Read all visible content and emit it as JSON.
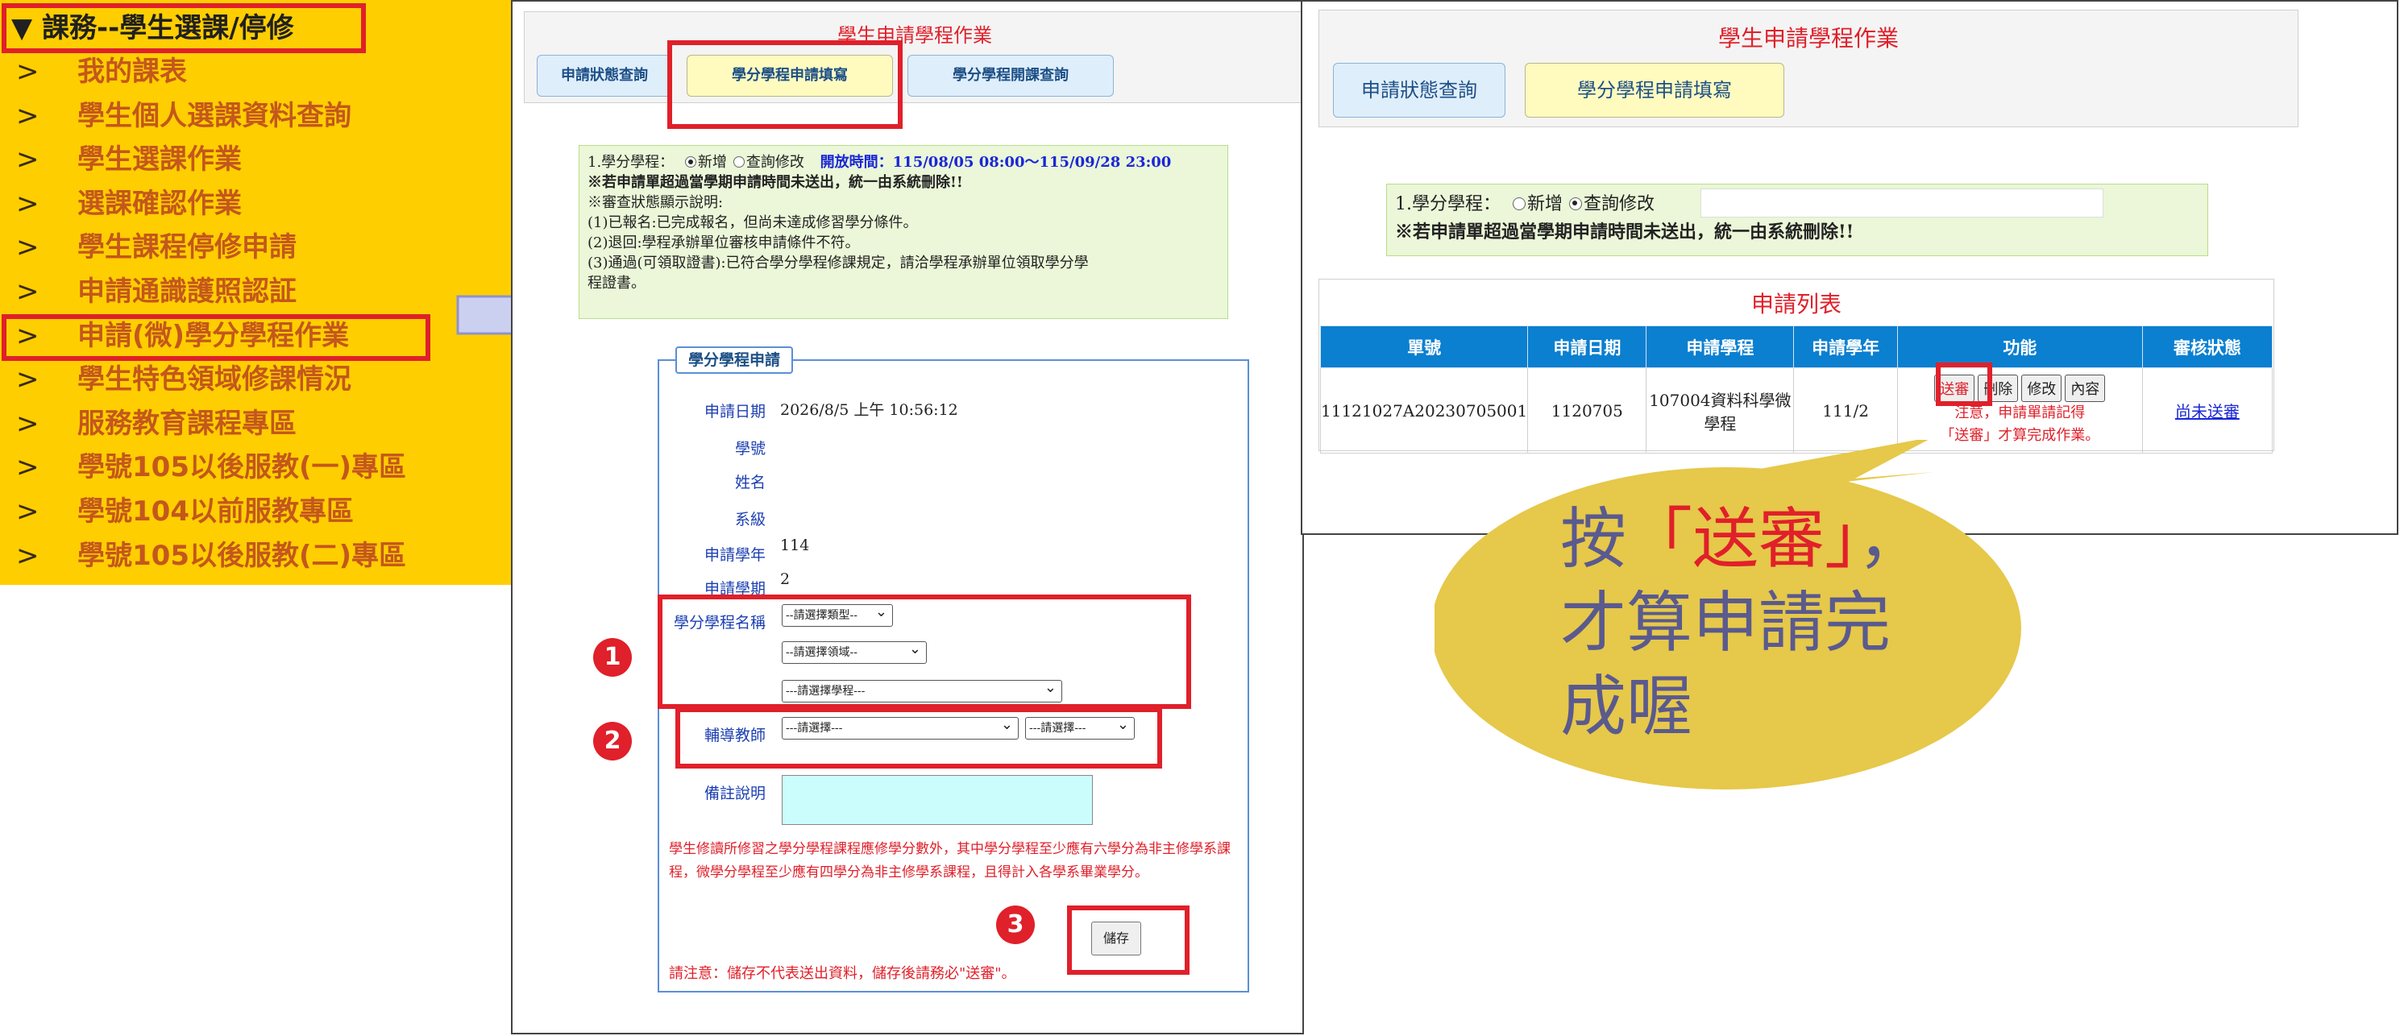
{
  "menu": {
    "header": "▼ 課務--學生選課/停修",
    "arrow_glyph": ">",
    "items": [
      "我的課表",
      "學生個人選課資料查詢",
      "學生選課作業",
      "選課確認作業",
      "學生課程停修申請",
      "申請通識護照認証",
      "申請(微)學分學程作業",
      "學生特色領域修課情況",
      "服務教育課程專區",
      "學號105以後服教(一)專區",
      "學號104以前服教專區",
      "學號105以後服教(二)專區"
    ]
  },
  "left_panel": {
    "title": "學生申請學程作業",
    "tabs": [
      "申請狀態查詢",
      "學分學程申請填寫",
      "學分學程開課查詢"
    ],
    "info": {
      "program_label": "1.學分學程：",
      "radio_new": "新增",
      "radio_query": "查詢修改",
      "open_time": "開放時間：115/08/05 08:00～115/09/28 23:00",
      "warning": "※若申請單超過當學期申請時間未送出，統一由系統刪除!!",
      "status_title": "※審查狀態顯示說明:",
      "status_1": "(1)已報名:已完成報名，但尚未達成修習學分條件。",
      "status_2": "(2)退回:學程承辦單位審核申請條件不符。",
      "status_3a": "(3)通過(可領取證書):已符合學分學程修課規定，請洽學程承辦單位領取學分學",
      "status_3b": "程證書。"
    },
    "form": {
      "legend": "學分學程申請",
      "apply_date_label": "申請日期",
      "apply_date_value": "2026/8/5 上午 10:56:12",
      "student_id_label": "學號",
      "name_label": "姓名",
      "dept_label": "系級",
      "year_label": "申請學年",
      "year_value": "114",
      "term_label": "申請學期",
      "term_value": "2",
      "program_name_label": "學分學程名稱",
      "select_type": "--請選擇類型--",
      "select_field": "--請選擇領域--",
      "select_program": "---請選擇學程---",
      "tutor_label": "輔導教師",
      "select_tutor_1": "---請選擇---",
      "select_tutor_2": "---請選擇---",
      "remark_label": "備註說明",
      "note": "學生修讀所修習之學分學程課程應修學分數外，其中學分學程至少應有六學分為非主修學系課程，微學分學程至少應有四學分為非主修學系課程，且得計入各學系畢業學分。",
      "save_label": "儲存",
      "save_note": "請注意：儲存不代表送出資料，儲存後請務必\"送審\"。"
    },
    "badges": [
      "1",
      "2",
      "3"
    ]
  },
  "right_panel": {
    "title": "學生申請學程作業",
    "tabs": [
      "申請狀態查詢",
      "學分學程申請填寫"
    ],
    "program_label": "1.學分學程：",
    "radio_new": "新增",
    "radio_query": "查詢修改",
    "warning": "※若申請單超過當學期申請時間未送出，統一由系統刪除!!",
    "list_title": "申請列表",
    "columns": [
      "單號",
      "申請日期",
      "申請學程",
      "申請學年",
      "功能",
      "審核狀態"
    ],
    "row": {
      "id": "11121027A20230705001",
      "date": "1120705",
      "program": "107004資料科學微學程",
      "year": "111/2",
      "btn_send": "送審",
      "btn_delete": "刪除",
      "btn_edit": "修改",
      "btn_content": "內容",
      "note_line1": "注意，申請單請記得",
      "note_line2": "「送審」才算完成作業。",
      "status": "尚未送審"
    }
  },
  "bubble": {
    "line1_prefix": "按",
    "line1_highlight": "「送審」",
    "line1_suffix": "，",
    "line2": "才算申請完",
    "line3": "成喔"
  },
  "colors": {
    "menu_bg": "#ffce00",
    "menu_text": "#c4571c",
    "highlight_red": "#e0202a",
    "table_header": "#0b7fd0",
    "info_bg": "#ebf7d8",
    "bubble_fill": "#e6c84a",
    "arrow_fill": "#ccd0f0"
  }
}
